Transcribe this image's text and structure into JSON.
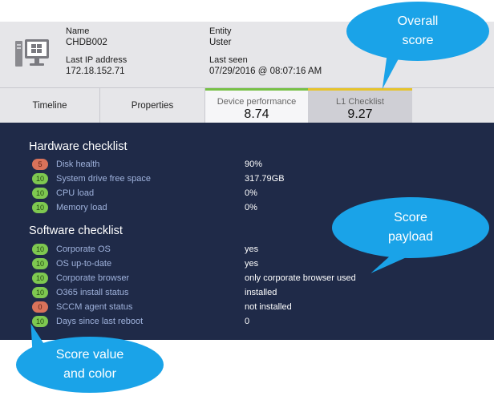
{
  "device": {
    "name_label": "Name",
    "name_value": "CHDB002",
    "ip_label": "Last IP address",
    "ip_value": "172.18.152.71",
    "entity_label": "Entity",
    "entity_value": "Uster",
    "seen_label": "Last seen",
    "seen_value": "07/29/2016 @ 08:07:16 AM"
  },
  "tabs": {
    "timeline": "Timeline",
    "properties": "Properties",
    "device_performance": {
      "label": "Device performance",
      "score": "8.74",
      "color": "#77c046"
    },
    "l1_checklist": {
      "label": "L1 Checklist",
      "score": "9.27",
      "color": "#e6c32c"
    }
  },
  "hardware": {
    "title": "Hardware checklist",
    "items": [
      {
        "score": "5",
        "color": "#d9725a",
        "label": "Disk health",
        "value": "90%"
      },
      {
        "score": "10",
        "color": "#7ec850",
        "label": "System drive free space",
        "value": "317.79GB"
      },
      {
        "score": "10",
        "color": "#7ec850",
        "label": "CPU load",
        "value": "0%"
      },
      {
        "score": "10",
        "color": "#7ec850",
        "label": "Memory load",
        "value": "0%"
      }
    ]
  },
  "software": {
    "title": "Software checklist",
    "items": [
      {
        "score": "10",
        "color": "#7ec850",
        "label": "Corporate OS",
        "value": "yes"
      },
      {
        "score": "10",
        "color": "#7ec850",
        "label": "OS up-to-date",
        "value": "yes"
      },
      {
        "score": "10",
        "color": "#7ec850",
        "label": "Corporate browser",
        "value": "only corporate browser used"
      },
      {
        "score": "10",
        "color": "#7ec850",
        "label": "O365 install status",
        "value": "installed"
      },
      {
        "score": "0",
        "color": "#d9725a",
        "label": "SCCM agent status",
        "value": "not installed"
      },
      {
        "score": "10",
        "color": "#7ec850",
        "label": "Days since last reboot",
        "value": "0"
      }
    ]
  },
  "callouts": {
    "overall_line1": "Overall",
    "overall_line2": "score",
    "payload_line1": "Score",
    "payload_line2": "payload",
    "value_line1": "Score value",
    "value_line2": "and color",
    "color": "#1aa3e8"
  }
}
